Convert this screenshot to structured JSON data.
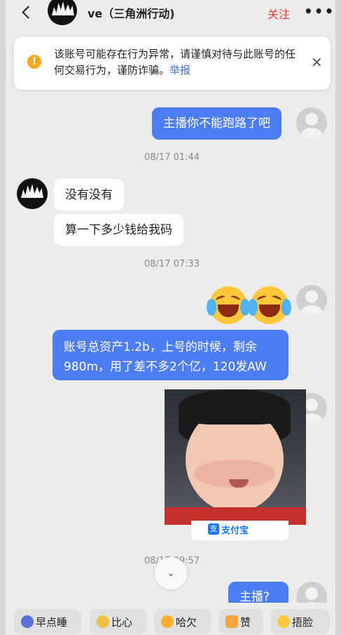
{
  "header": {
    "title": "ve（三角洲行动)",
    "follow_label": "关注",
    "more_label": "•••"
  },
  "banner": {
    "text": "该账号可能存在行为异常，请谨慎对待与此账号的任何交易行为，谨防诈骗。",
    "link": "举报",
    "close": "×"
  },
  "messages": {
    "m1": "主播你不能跑路了吧",
    "t1": "08/17 01:44",
    "m2": "没有没有",
    "m3": "算一下多少钱给我码",
    "t2": "08/17 07:33",
    "m4": "账号总资产1.2b，上号的时候，剩余980m，用了差不多2个亿，120发AW",
    "image_caption": "支付宝",
    "t3": "08/17 09:57",
    "m5": "主播?"
  },
  "scroll_down_label": "⌄",
  "quick_replies": [
    "早点睡",
    "比心",
    "哈欠",
    "赞",
    "捂脸"
  ]
}
